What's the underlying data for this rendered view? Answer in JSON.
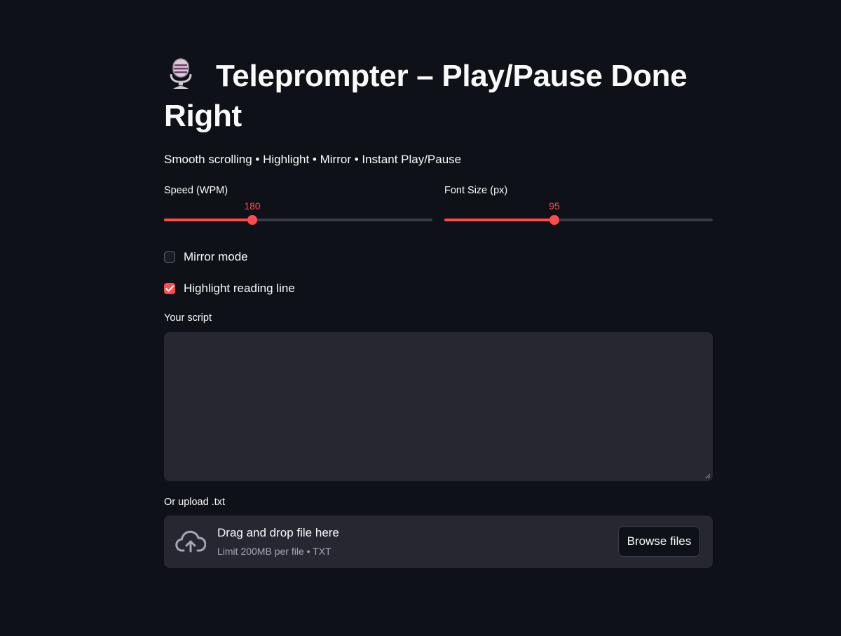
{
  "header": {
    "title": "Teleprompter – Play/Pause Done Right",
    "subtitle": "Smooth scrolling • Highlight • Mirror • Instant Play/Pause"
  },
  "sliders": {
    "speed": {
      "label": "Speed (WPM)",
      "value": "180",
      "fraction": 0.33
    },
    "font_size": {
      "label": "Font Size (px)",
      "value": "95",
      "fraction": 0.41
    }
  },
  "checkboxes": {
    "mirror": {
      "label": "Mirror mode",
      "checked": false
    },
    "highlight": {
      "label": "Highlight reading line",
      "checked": true
    }
  },
  "script_input": {
    "label": "Your script",
    "value": ""
  },
  "uploader": {
    "label": "Or upload .txt",
    "drop_text": "Drag and drop file here",
    "limit_text": "Limit 200MB per file • TXT",
    "browse_label": "Browse files"
  },
  "colors": {
    "background": "#0e1117",
    "accent": "#ff4b4b",
    "surface": "#262730"
  },
  "icons": {
    "title": "microphone-icon",
    "upload": "cloud-upload-icon",
    "checkmark": "checkmark-icon"
  }
}
